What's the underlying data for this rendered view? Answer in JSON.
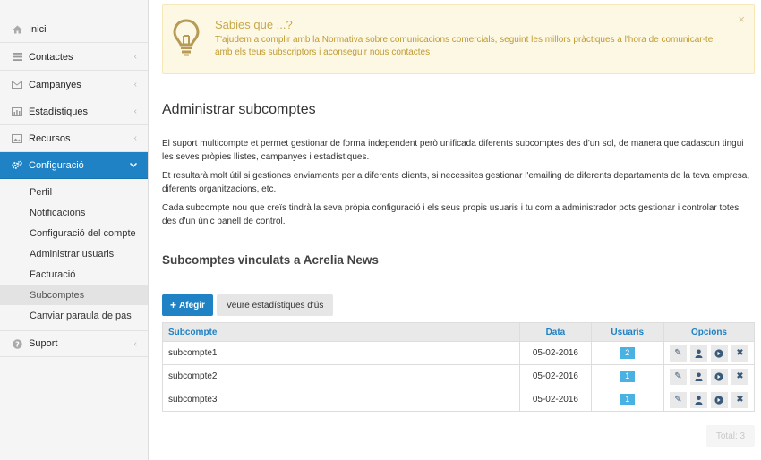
{
  "sidebar": {
    "items": [
      {
        "label": "Inici",
        "icon": "home-icon"
      },
      {
        "label": "Contactes",
        "icon": "list-icon"
      },
      {
        "label": "Campanyes",
        "icon": "envelope-icon"
      },
      {
        "label": "Estadístiques",
        "icon": "bar-chart-icon"
      },
      {
        "label": "Recursos",
        "icon": "image-icon"
      },
      {
        "label": "Configuració",
        "icon": "cogs-icon"
      },
      {
        "label": "Suport",
        "icon": "question-icon"
      }
    ],
    "config_subitems": [
      "Perfil",
      "Notificacions",
      "Configuració del compte",
      "Administrar usuaris",
      "Facturació",
      "Subcomptes",
      "Canviar paraula de pas"
    ]
  },
  "alert": {
    "title": "Sabies que ...?",
    "text": "T'ajudem a complir amb la Normativa sobre comunicacions comercials, seguint les millors pràctiques a l'hora de comunicar-te amb els teus subscriptors i aconseguir nous contactes",
    "close": "×"
  },
  "main": {
    "title": "Administrar subcomptes",
    "paragraphs": [
      "El suport multicompte et permet gestionar de forma independent però unificada diferents subcomptes des d'un sol, de manera que cadascun tingui les seves pròpies llistes, campanyes i estadístiques.",
      "Et resultarà molt útil si gestiones enviaments per a diferents clients, si necessites gestionar l'emailing de diferents departaments de la teva empresa, diferents organitzacions, etc.",
      "Cada subcompte nou que creïs tindrà la seva pròpia configuració i els seus propis usuaris i tu com a administrador pots gestionar i controlar totes des d'un únic panell de control."
    ],
    "section_title": "Subcomptes vinculats a Acrelia News",
    "add_button": "Afegir",
    "stats_button": "Veure estadístiques d'ús",
    "table": {
      "headers": {
        "name": "Subcompte",
        "date": "Data",
        "users": "Usuaris",
        "options": "Opcions"
      },
      "rows": [
        {
          "name": "subcompte1",
          "date": "05-02-2016",
          "users": "2"
        },
        {
          "name": "subcompte2",
          "date": "05-02-2016",
          "users": "1"
        },
        {
          "name": "subcompte3",
          "date": "05-02-2016",
          "users": "1"
        }
      ]
    },
    "total": "Total: 3"
  },
  "colors": {
    "primary": "#1e82c4",
    "badge": "#49b2e3",
    "alert_bg": "#fcf8e3",
    "alert_text": "#c09a33"
  }
}
